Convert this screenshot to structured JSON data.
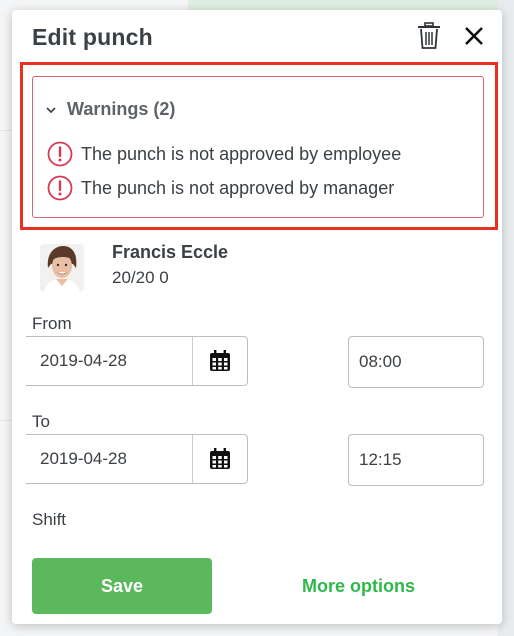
{
  "dialog": {
    "title": "Edit punch",
    "delete_icon": "trash-icon",
    "close_icon": "close-icon"
  },
  "warnings": {
    "header": "Warnings (2)",
    "toggle_icon": "chevron-down-icon",
    "items": [
      {
        "icon": "exclamation-circle-icon",
        "text": "The punch is not approved by employee"
      },
      {
        "icon": "exclamation-circle-icon",
        "text": "The punch is not approved by manager"
      }
    ],
    "colors": {
      "border": "#d86677",
      "icon": "#d73a52",
      "highlight": "#e8321f"
    }
  },
  "employee": {
    "name": "Francis Eccle",
    "subtitle": "20/20 0"
  },
  "from": {
    "label": "From",
    "date": "2019-04-28",
    "time": "08:00",
    "calendar_icon": "calendar-icon"
  },
  "to": {
    "label": "To",
    "date": "2019-04-28",
    "time": "12:15",
    "calendar_icon": "calendar-icon"
  },
  "shift": {
    "label": "Shift"
  },
  "actions": {
    "save": "Save",
    "more_options": "More options",
    "colors": {
      "save_bg": "#5cb85c",
      "link": "#2fb84a"
    }
  }
}
